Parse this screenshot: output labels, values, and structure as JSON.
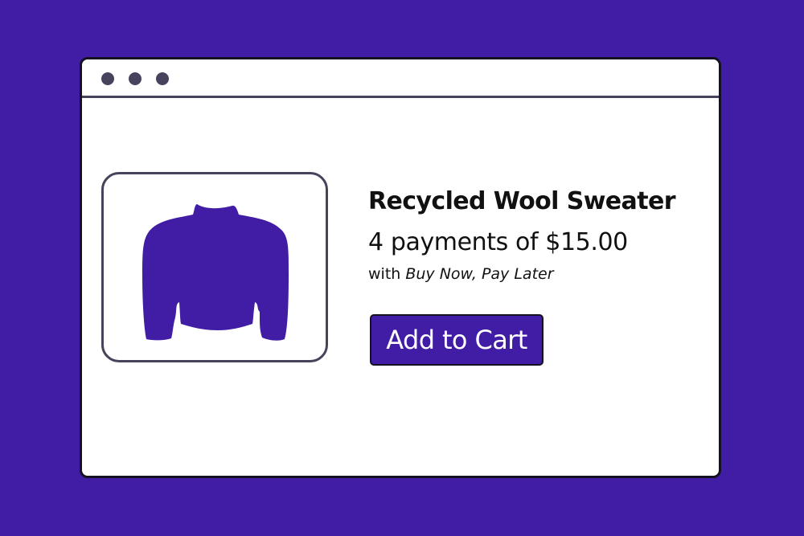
{
  "colors": {
    "background": "#411ca4",
    "window": "#ffffff",
    "window_border": "#141220",
    "chrome_gray": "#48435c",
    "product_accent": "#411ca4",
    "text": "#111111",
    "button_text": "#ffffff"
  },
  "window": {
    "control_dots": [
      "dot",
      "dot",
      "dot"
    ]
  },
  "product": {
    "image_icon": "sweater-icon",
    "title": "Recycled Wool Sweater",
    "price_text": "4 payments of $15.00",
    "financing_prefix": "with ",
    "financing_provider": "Buy Now, Pay Later",
    "add_to_cart_label": "Add to Cart"
  }
}
